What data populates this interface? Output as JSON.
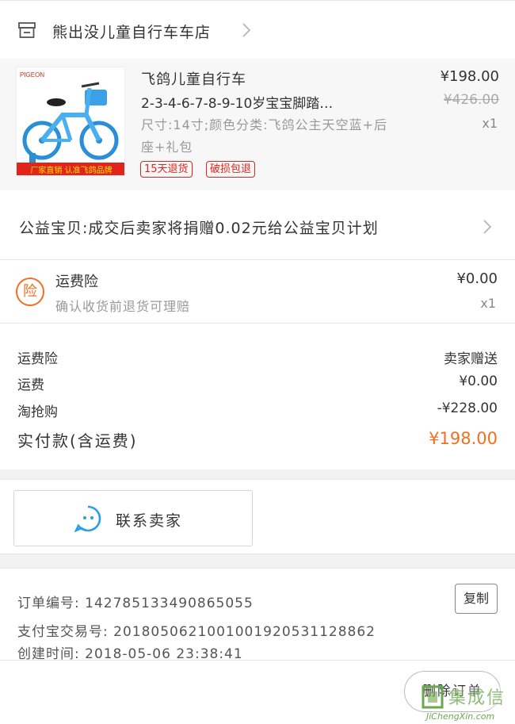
{
  "shop": {
    "name": "熊出没儿童自行车车店"
  },
  "product": {
    "title": "飞鸽儿童自行车",
    "subtitle": "2-3-4-6-7-8-9-10岁宝宝脚踏…",
    "spec": "尺寸:14寸;颜色分类:飞鸽公主天空蓝+后座+礼包",
    "price": "¥198.00",
    "original_price": "¥426.00",
    "quantity": "x1",
    "tags": [
      "15天退货",
      "破损包退"
    ],
    "image_brand": "PIGEON 中国飞鸽",
    "image_banner": "厂家直销 认准飞鸽品牌"
  },
  "charity": {
    "text": "公益宝贝:成交后卖家将捐赠0.02元给公益宝贝计划"
  },
  "insurance": {
    "badge": "险",
    "title": "运费险",
    "subtitle": "确认收货前退货可理赔",
    "price": "¥0.00",
    "quantity": "x1"
  },
  "summary": {
    "rows": [
      {
        "label": "运费险",
        "value": "卖家赠送"
      },
      {
        "label": "运费",
        "value": "¥0.00"
      },
      {
        "label": "淘抢购",
        "value": "-¥228.00"
      }
    ],
    "paid_label": "实付款(含运费)",
    "paid_value": "¥198.00"
  },
  "contact": {
    "label": "联系卖家"
  },
  "order_info": {
    "order_no": "订单编号: 142785133490865055",
    "alipay_no": "支付宝交易号: 2018050621001001920531128862",
    "created": "创建时间: 2018-05-06 23:38:41",
    "copy_label": "复制"
  },
  "footer": {
    "delete_label": "删除订单",
    "watermark_text": "集成信",
    "watermark_site": "JiChengXin.com"
  },
  "colors": {
    "accent": "#f26f21",
    "tag_red": "#e1251b",
    "contact_blue": "#2b9ee8"
  }
}
